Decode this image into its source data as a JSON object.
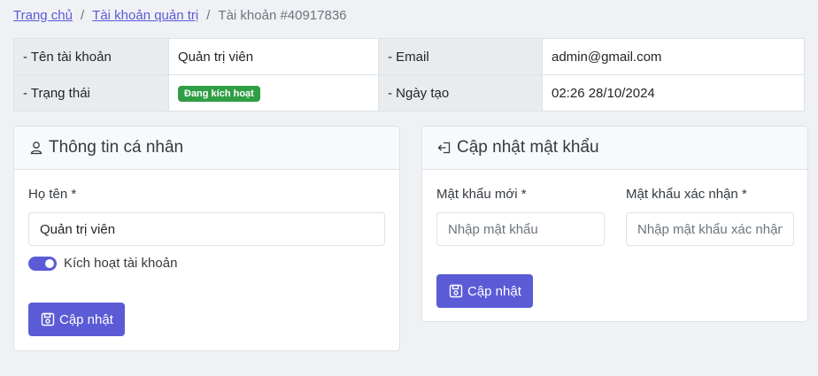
{
  "breadcrumb": {
    "home": "Trang chủ",
    "accounts": "Tài khoản quản trị",
    "current": "Tài khoản #40917836",
    "separator": "/"
  },
  "info": {
    "name_label": "- Tên tài khoản",
    "name_value": "Quản trị viên",
    "email_label": "- Email",
    "email_value": "admin@gmail.com",
    "status_label": "- Trạng thái",
    "status_value": "Đang kích hoạt",
    "created_label": "- Ngày tạo",
    "created_value": "02:26 28/10/2024"
  },
  "profile": {
    "title": "Thông tin cá nhân",
    "fullname_label": "Họ tên *",
    "fullname_value": "Quản trị viên",
    "active_label": "Kích hoạt tài khoản",
    "active_on": true,
    "submit_label": "Cập nhật"
  },
  "password": {
    "title": "Cập nhật mật khẩu",
    "new_label": "Mật khẩu mới *",
    "new_placeholder": "Nhập mật khẩu",
    "confirm_label": "Mật khẩu xác nhận *",
    "confirm_placeholder": "Nhập mật khẩu xác nhận",
    "submit_label": "Cập nhật"
  },
  "colors": {
    "accent": "#5b5bd6",
    "status_badge": "#2f9e44"
  },
  "icons": {
    "profile": "user-icon",
    "password": "sign-in-icon",
    "save": "floppy-disk-icon"
  }
}
